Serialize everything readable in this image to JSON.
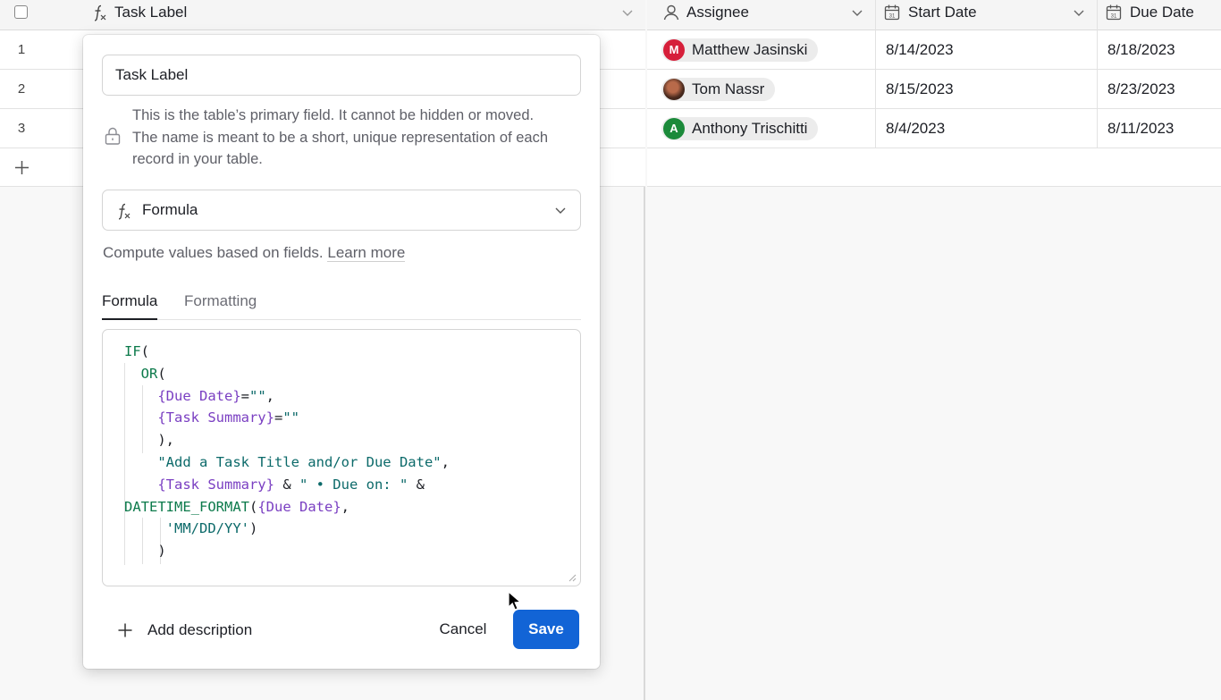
{
  "grid": {
    "columns": {
      "primary": "Task Label",
      "assignee": "Assignee",
      "start_date": "Start Date",
      "due_date": "Due Date"
    },
    "rows": [
      {
        "num": "1",
        "assignee": "Matthew Jasinski",
        "avatar_initial": "M",
        "avatar_color": "#d61f3a",
        "start": "8/14/2023",
        "due": "8/18/2023"
      },
      {
        "num": "2",
        "assignee": "Tom Nassr",
        "avatar_initial": "",
        "avatar_color": "#6a3b2a",
        "start": "8/15/2023",
        "due": "8/23/2023"
      },
      {
        "num": "3",
        "assignee": "Anthony Trischitti",
        "avatar_initial": "A",
        "avatar_color": "#1b8a3a",
        "start": "8/4/2023",
        "due": "8/11/2023"
      }
    ]
  },
  "dialog": {
    "field_name": "Task Label",
    "primary_note": "This is the table’s primary field. It cannot be hidden or moved. The name is meant to be a short, unique representation of each record in your table.",
    "field_type": "Formula",
    "compute_note": "Compute values based on fields.",
    "learn_more": "Learn more",
    "tabs": [
      "Formula",
      "Formatting"
    ],
    "formula_lines": [
      "IF(",
      "  OR(",
      "    {Due Date}=\"\",",
      "    {Task Summary}=\"\"",
      "    ),",
      "    \"Add a Task Title and/or Due Date\",",
      "    {Task Summary} & \" • Due on: \" &",
      "DATETIME_FORMAT({Due Date},",
      "     'MM/DD/YY')",
      "    )"
    ],
    "add_description": "Add description",
    "cancel": "Cancel",
    "save": "Save"
  },
  "colors": {
    "accent": "#1264d6",
    "formula_function": "#0c7a4b",
    "formula_field": "#7a3fc2",
    "formula_string": "#0c6a6a"
  },
  "icons": [
    "formula-icon",
    "chevron-down-icon",
    "user-icon",
    "calendar-icon",
    "lock-icon",
    "plus-icon",
    "cursor-arrow-icon"
  ]
}
